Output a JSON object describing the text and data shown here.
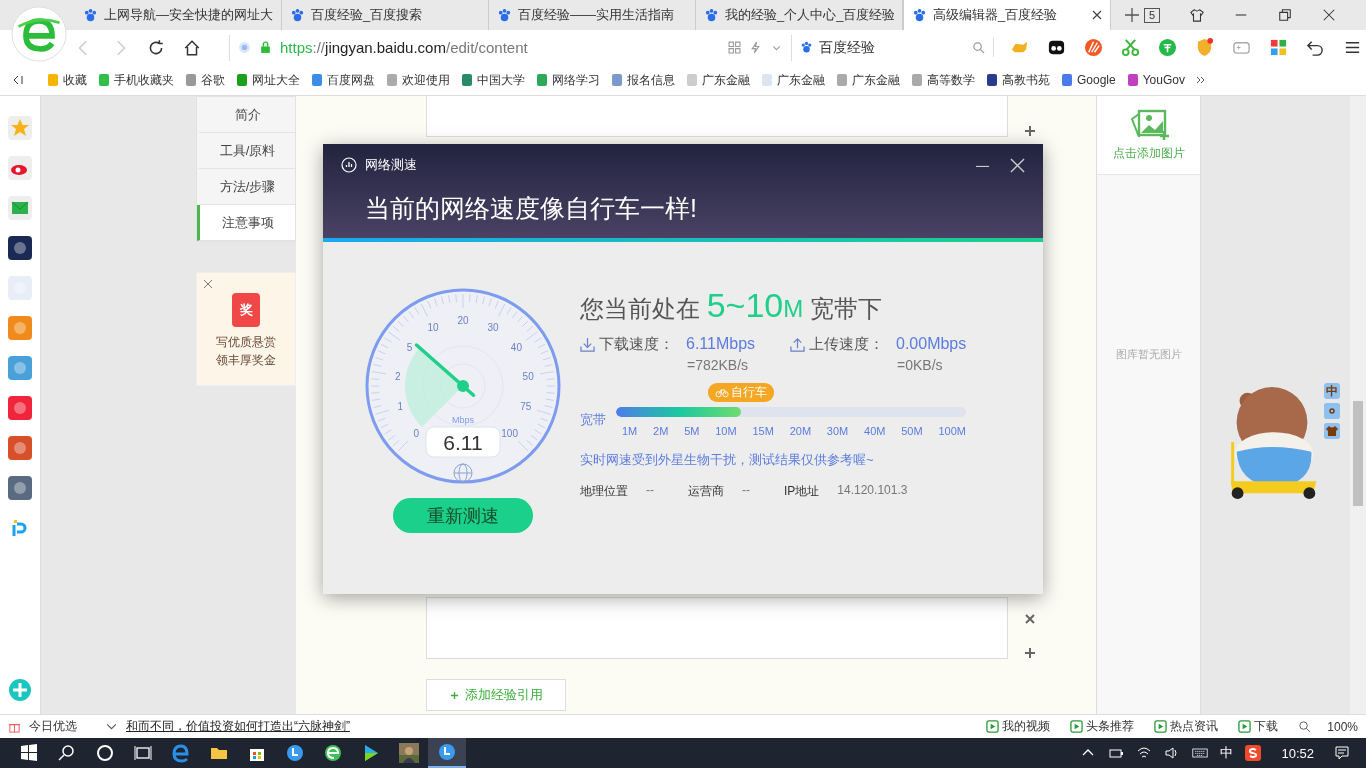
{
  "browser": {
    "tabs": [
      {
        "label": "上网导航—安全快捷的网址大",
        "selected": false
      },
      {
        "label": "百度经验_百度搜索",
        "selected": false
      },
      {
        "label": "百度经验——实用生活指南",
        "selected": false
      },
      {
        "label": "我的经验_个人中心_百度经验",
        "selected": false
      },
      {
        "label": "高级编辑器_百度经验",
        "selected": true
      }
    ],
    "tab_count": "5",
    "url": {
      "scheme": "https",
      "separator": "://",
      "host": "jingyan.baidu.com",
      "path": "/edit/content"
    },
    "search_engine": "百度经验",
    "bookmarks": [
      "收藏",
      "手机收藏夹",
      "谷歌",
      "网址大全",
      "百度网盘",
      "欢迎使用",
      "中国大学",
      "网络学习",
      "报名信息",
      "广东金融",
      "广东金融",
      "广东金融",
      "高等数学",
      "高教书苑",
      "Google",
      "YouGov"
    ]
  },
  "article_nav": [
    {
      "label": "简介",
      "selected": false
    },
    {
      "label": "工具/原料",
      "selected": false
    },
    {
      "label": "方法/步骤",
      "selected": false
    },
    {
      "label": "注意事项",
      "selected": true
    }
  ],
  "reward_card": {
    "badge": "奖",
    "lines": [
      "写优质悬赏",
      "领丰厚奖金"
    ]
  },
  "add_reference_button": "添加经验引用",
  "image_panel": {
    "add_label": "点击添加图片",
    "empty_text": "图库暂无图片"
  },
  "ime_toolbar": {
    "mode": "中"
  },
  "speed_test": {
    "window_title": "网络测速",
    "headline": "当前的网络速度像自行车一样!",
    "summary": {
      "prefix": "您当前处在",
      "range": "5~10",
      "unit": "M",
      "suffix": "宽带下"
    },
    "download": {
      "label": "下载速度：",
      "value": "6.11Mbps",
      "converted": "=782KB/s"
    },
    "upload": {
      "label": "上传速度：",
      "value": "0.00Mbps",
      "converted": "=0KB/s"
    },
    "gauge": {
      "unit": "Mbps",
      "reading": "6.11",
      "ticks": [
        "0",
        "1",
        "2",
        "5",
        "10",
        "20",
        "30",
        "40",
        "50",
        "75",
        "100"
      ]
    },
    "bandwidth": {
      "label": "宽带",
      "level": 0.357,
      "badge": "自行车",
      "ticks": [
        "1M",
        "2M",
        "5M",
        "10M",
        "15M",
        "20M",
        "30M",
        "40M",
        "50M",
        "100M"
      ]
    },
    "notice": "实时网速受到外星生物干扰，测试结果仅供参考喔~",
    "info": [
      {
        "label": "地理位置",
        "value": "--"
      },
      {
        "label": "运营商",
        "value": "--"
      },
      {
        "label": "IP地址",
        "value": "14.120.101.3"
      }
    ],
    "retest_button": "重新测速"
  },
  "status_bar": {
    "label": "今日优选",
    "headline": "和而不同，价值投资如何打造出“六脉神剑”",
    "items": [
      "我的视频",
      "头条推荐",
      "热点资讯",
      "下载"
    ],
    "zoom": "100%"
  },
  "taskbar": {
    "ime": "中",
    "time": "10:52"
  }
}
